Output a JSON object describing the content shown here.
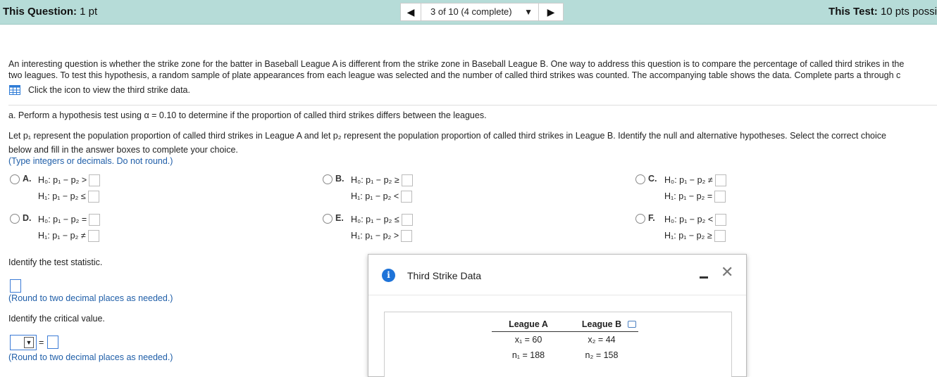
{
  "header": {
    "question_label": "This Question:",
    "question_points": "1 pt",
    "progress": "3 of 10 (4 complete)",
    "prev_glyph": "◀",
    "next_glyph": "▶",
    "dropdown_glyph": "▼",
    "test_label": "This Test:",
    "test_points": "10 pts possi"
  },
  "intro": {
    "line1": "An interesting question is whether the strike zone for the batter in Baseball League A is different from the strike zone in Baseball League B. One way to address this question is to compare the percentage of called third strikes in the",
    "line2": "two leagues. To test this hypothesis, a random sample of plate appearances from each league was selected and the number of called third strikes was counted. The accompanying table shows the data. Complete parts a through c",
    "link": "Click the icon to view the third strike data."
  },
  "part_a": {
    "prompt": "a. Perform a hypothesis test using α = 0.10 to determine if the proportion of called third strikes differs between the leagues.",
    "let_line1": "Let p₁ represent the population proportion of called third strikes in League A and let p₂ represent the population proportion of called third strikes in League B. Identify the null and alternative hypotheses. Select the correct choice",
    "let_line2": "below and fill in the answer boxes to complete your choice.",
    "hint": "(Type integers or decimals. Do not round.)"
  },
  "choices": [
    {
      "letter": "A.",
      "h0": "H₀: p₁ − p₂ >",
      "h1": "H₁: p₁ − p₂ ≤"
    },
    {
      "letter": "B.",
      "h0": "H₀: p₁ − p₂ ≥",
      "h1": "H₁: p₁ − p₂ <"
    },
    {
      "letter": "C.",
      "h0": "H₀: p₁ − p₂ ≠",
      "h1": "H₁: p₁ − p₂ ="
    },
    {
      "letter": "D.",
      "h0": "H₀: p₁ − p₂ =",
      "h1": "H₁: p₁ − p₂ ≠"
    },
    {
      "letter": "E.",
      "h0": "H₀: p₁ − p₂ ≤",
      "h1": "H₁: p₁ − p₂ >"
    },
    {
      "letter": "F.",
      "h0": "H₀: p₁ − p₂ <",
      "h1": "H₁: p₁ − p₂ ≥"
    }
  ],
  "test_stat": {
    "label": "Identify the test statistic.",
    "hint": "(Round to two decimal places as needed.)"
  },
  "critical": {
    "label": "Identify the critical value.",
    "equals": "=",
    "hint": "(Round to two decimal places as needed.)"
  },
  "dialog": {
    "title": "Third Strike Data",
    "info_glyph": "i",
    "close_glyph": "✕",
    "table": {
      "headers": [
        "League A",
        "League B"
      ],
      "rows": [
        [
          "x₁ = 60",
          "x₂ = 44"
        ],
        [
          "n₁ = 188",
          "n₂ = 158"
        ]
      ]
    }
  },
  "colors": {
    "topbar": "#b6dcd8",
    "link_blue": "#1f5ea8",
    "info_blue": "#1e73d8"
  }
}
